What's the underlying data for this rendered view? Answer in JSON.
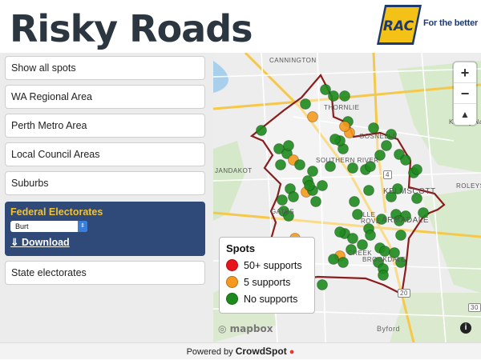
{
  "header": {
    "title": "Risky Roads",
    "logo_badge": "RAC",
    "logo_tagline": "For the better"
  },
  "sidebar": {
    "items": [
      {
        "label": "Show all spots"
      },
      {
        "label": "WA Regional Area"
      },
      {
        "label": "Perth Metro Area"
      },
      {
        "label": "Local Council Areas"
      },
      {
        "label": "Suburbs"
      },
      {
        "label": "State electorates"
      }
    ],
    "active": {
      "title": "Federal Electorates",
      "select_value": "Burt",
      "download_label": "Download"
    }
  },
  "map": {
    "zoom_in": "+",
    "zoom_out": "−",
    "compass": "▲",
    "attribution": "mapbox",
    "info": "i",
    "places": [
      "CANNINGTON",
      "THORNLIE",
      "GOSNELLS",
      "SOUTHERN RIVER",
      "JANDAKOT",
      "KELMSCOTT",
      "ARMADALE",
      "BROOKDALE",
      "Byford",
      "Korung Nati",
      "ROLEYSTO",
      "GATES",
      "ILLE",
      "ROVE",
      "CREEK",
      "4",
      "20",
      "30"
    ],
    "legend": {
      "title": "Spots",
      "items": [
        {
          "label": "50+ supports",
          "color": "#e8141b"
        },
        {
          "label": "5 supports",
          "color": "#f59a1e"
        },
        {
          "label": "No supports",
          "color": "#1e8a1e"
        }
      ]
    }
  },
  "footer": {
    "prefix": "Powered by",
    "brand": "CrowdSpot"
  }
}
